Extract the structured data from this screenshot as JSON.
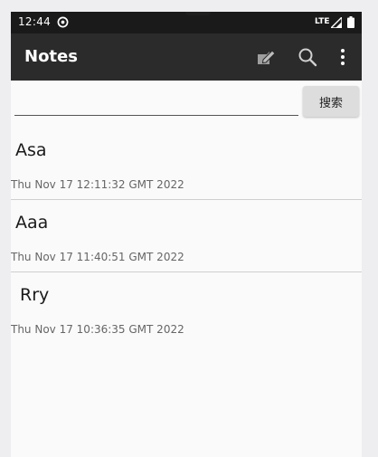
{
  "status_bar": {
    "time": "12:44",
    "network": "LTE",
    "icons": [
      "sync-icon",
      "signal-icon",
      "battery-icon"
    ]
  },
  "app_bar": {
    "title": "Notes",
    "actions": [
      "edit-note-icon",
      "search-icon",
      "more-vertical-icon"
    ],
    "background": "#2b2b2b",
    "status_background": "#1a1a1a"
  },
  "search": {
    "value": "",
    "placeholder": "",
    "button_label": "搜索"
  },
  "notes": [
    {
      "title": "Asa",
      "date": "Thu Nov 17 12:11:32 GMT 2022"
    },
    {
      "title": "Aaa",
      "date": "Thu Nov 17 11:40:51 GMT 2022"
    },
    {
      "title": "Rry",
      "date": "Thu Nov 17 10:36:35 GMT 2022"
    }
  ]
}
